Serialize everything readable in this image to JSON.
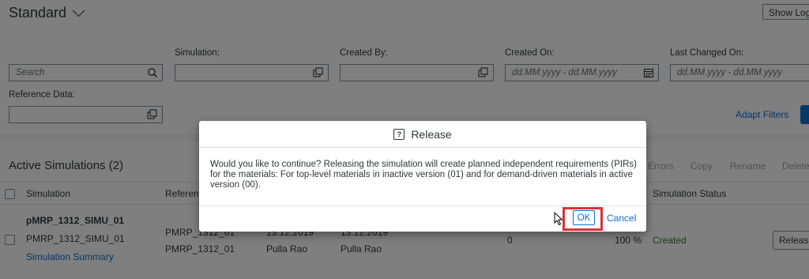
{
  "header": {
    "variant_title": "Standard",
    "show_log_label": "Show Log"
  },
  "filters": {
    "search_placeholder": "Search",
    "simulation_label": "Simulation:",
    "created_by_label": "Created By:",
    "created_on_label": "Created On:",
    "created_on_placeholder": "dd.MM.yyyy - dd.MM.yyyy",
    "last_changed_label": "Last Changed On:",
    "last_changed_placeholder": "dd.MM.yyyy - dd.MM.yyyy",
    "reference_data_label": "Reference Data:",
    "adapt_filters_label": "Adapt Filters"
  },
  "table": {
    "title": "Active Simulations (2)",
    "toolbar": [
      "Errors",
      "Copy",
      "Rename",
      "Delete"
    ],
    "columns": {
      "simulation": "Simulation",
      "reference": "Referen",
      "status": "Simulation Status"
    },
    "row": {
      "title": "pMRP_1312_SIMU_01",
      "name": "PMRP_1312_SIMU_01",
      "summary_link": "Simulation Summary",
      "reference_1": "PMRP_1312_01",
      "reference_2": "PMRP_1312_01",
      "created_date": "13.12.2019",
      "changed_date": "13.12.2019",
      "created_by": "Pulla Rao",
      "changed_by": "Pulla Rao",
      "count": "0",
      "percent": "100 %",
      "status": "Created",
      "action_label": "Release"
    }
  },
  "dialog": {
    "title": "Release",
    "message": "Would you like to continue? Releasing the simulation will create planned independent requirements (PIRs) for the materials: For top-level materials in inactive version (01) and for demand-driven materials in active version (00).",
    "ok_label": "OK",
    "cancel_label": "Cancel"
  },
  "colors": {
    "accent": "#0a6ed1",
    "success": "#2b7d2b",
    "highlight": "#e0303b"
  }
}
